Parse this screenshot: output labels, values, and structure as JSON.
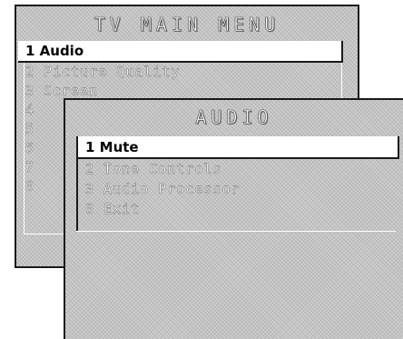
{
  "main_menu": {
    "title": "TV MAIN MENU",
    "items": [
      {
        "label": "1 Audio",
        "selected": true
      },
      {
        "label": "2 Picture Quality",
        "selected": false
      },
      {
        "label": "3 Screen",
        "selected": false
      },
      {
        "label": "4",
        "selected": false
      },
      {
        "label": "5",
        "selected": false
      },
      {
        "label": "6",
        "selected": false
      },
      {
        "label": "7",
        "selected": false
      },
      {
        "label": "0",
        "selected": false
      }
    ]
  },
  "audio_menu": {
    "title": "AUDIO",
    "items": [
      {
        "label": "1 Mute",
        "selected": true
      },
      {
        "label": "2 Tone Controls",
        "selected": false
      },
      {
        "label": "3 Audio Processor",
        "selected": false
      },
      {
        "label": "0 Exit",
        "selected": false
      }
    ]
  }
}
